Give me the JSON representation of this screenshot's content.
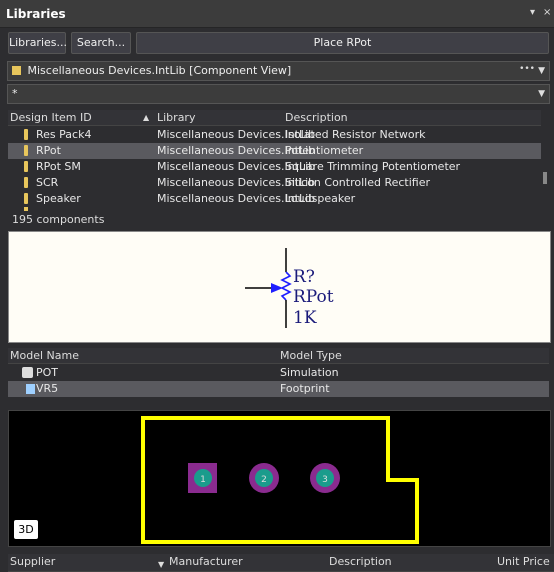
{
  "panel": {
    "title": "Libraries",
    "menu_icon": "▾",
    "close_icon": "×"
  },
  "buttons": {
    "libraries": "Libraries...",
    "search": "Search...",
    "place": "Place RPot"
  },
  "library_select": {
    "value": "Miscellaneous Devices.IntLib [Component View]",
    "more": "•••"
  },
  "filter": {
    "value": "*"
  },
  "components": {
    "headers": [
      "Design Item ID",
      "Library",
      "Description"
    ],
    "rows": [
      {
        "id": "Res Pack4",
        "library": "Miscellaneous Devices.IntLib",
        "description": "Isolated Resistor Network"
      },
      {
        "id": "RPot",
        "library": "Miscellaneous Devices.IntLib",
        "description": "Potentiometer"
      },
      {
        "id": "RPot SM",
        "library": "Miscellaneous Devices.IntLib",
        "description": "Square Trimming Potentiometer"
      },
      {
        "id": "SCR",
        "library": "Miscellaneous Devices.IntLib",
        "description": "Silicon Controlled Rectifier"
      },
      {
        "id": "Speaker",
        "library": "Miscellaneous Devices.IntLib",
        "description": "Loudspeaker"
      }
    ],
    "count": "195 components"
  },
  "symbol": {
    "designator": "R?",
    "comment": "RPot",
    "value": "1K"
  },
  "models": {
    "headers": [
      "Model Name",
      "Model Type"
    ],
    "rows": [
      {
        "name": "POT",
        "type": "Simulation"
      },
      {
        "name": "VR5",
        "type": "Footprint"
      }
    ]
  },
  "pcb": {
    "pads": [
      "1",
      "2",
      "3"
    ],
    "view_mode": "3D"
  },
  "suppliers": {
    "headers": [
      "Supplier",
      "Manufacturer",
      "Description",
      "Unit Price"
    ]
  },
  "colors": {
    "selection": "#5a5a5f",
    "outline": "#ffff00",
    "pad": "#1a9c8c",
    "pad_ring": "#8a2b8f"
  }
}
